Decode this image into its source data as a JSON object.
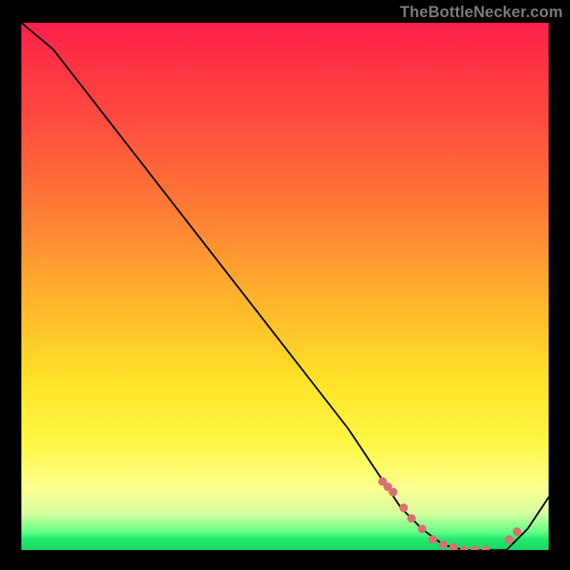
{
  "attribution": "TheBottleNecker.com",
  "chart_data": {
    "type": "line",
    "title": "",
    "xlabel": "",
    "ylabel": "",
    "xlim": [
      0,
      100
    ],
    "ylim": [
      0,
      100
    ],
    "x": [
      0,
      6,
      13,
      20,
      27,
      34,
      41,
      48,
      55,
      62,
      68,
      72,
      76,
      80,
      84,
      88,
      92,
      96,
      100
    ],
    "values": [
      100,
      95,
      86,
      77,
      68,
      59,
      50,
      41,
      32,
      23,
      14,
      8,
      4,
      1,
      0,
      0,
      0,
      4,
      10
    ],
    "markers": {
      "x": [
        68.5,
        69.5,
        70.5,
        72.5,
        74,
        76,
        78,
        80,
        82,
        84,
        86,
        88,
        92.5,
        94
      ],
      "y": [
        13,
        12,
        11,
        8,
        6,
        4,
        2,
        1,
        0.5,
        0,
        0,
        0,
        2,
        3.5
      ],
      "color": "#d87070",
      "size": 6
    }
  }
}
